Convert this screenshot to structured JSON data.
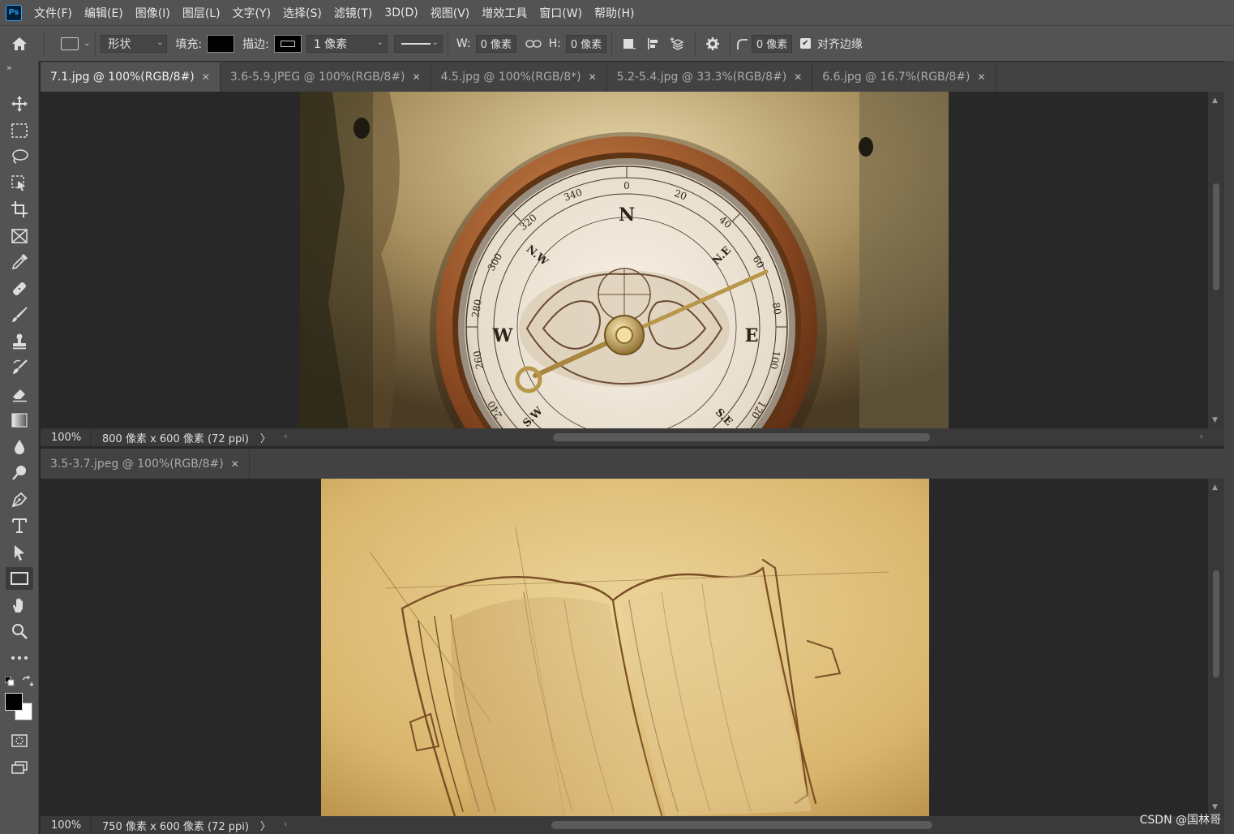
{
  "app": {
    "logo": "Ps"
  },
  "menu": [
    "文件(F)",
    "编辑(E)",
    "图像(I)",
    "图层(L)",
    "文字(Y)",
    "选择(S)",
    "滤镜(T)",
    "3D(D)",
    "视图(V)",
    "增效工具",
    "窗口(W)",
    "帮助(H)"
  ],
  "options": {
    "mode": "形状",
    "fill_label": "填充:",
    "stroke_label": "描边:",
    "stroke_width": "1 像素",
    "w_label": "W:",
    "w_value": "0 像素",
    "h_label": "H:",
    "h_value": "0 像素",
    "radius_value": "0 像素",
    "align_edges_label": "对齐边缘",
    "align_edges_checked": true
  },
  "tools": [
    "move-tool",
    "rectangular-marquee-tool",
    "lasso-tool",
    "object-selection-tool",
    "crop-tool",
    "frame-tool",
    "eyedropper-tool",
    "healing-brush-tool",
    "brush-tool",
    "clone-stamp-tool",
    "history-brush-tool",
    "eraser-tool",
    "gradient-tool",
    "blur-tool",
    "dodge-tool",
    "pen-tool",
    "type-tool",
    "path-selection-tool",
    "rectangle-tool",
    "hand-tool",
    "zoom-tool",
    "more-tools"
  ],
  "active_tool": "rectangle-tool",
  "colors": {
    "foreground": "#000000",
    "background": "#ffffff",
    "accent": "#31a8ff",
    "panel": "#535353",
    "workspace": "#282828"
  },
  "top_pane": {
    "tabs": [
      {
        "label": "7.1.jpg @ 100%(RGB/8#)",
        "active": true
      },
      {
        "label": "3.6-5.9.JPEG @ 100%(RGB/8#)",
        "active": false
      },
      {
        "label": "4.5.jpg @ 100%(RGB/8*)",
        "active": false
      },
      {
        "label": "5.2-5.4.jpg @ 33.3%(RGB/8#)",
        "active": false
      },
      {
        "label": "6.6.jpg @ 16.7%(RGB/8#)",
        "active": false
      }
    ],
    "zoom": "100%",
    "doc_info": "800 像素 x 600 像素 (72 ppi)",
    "compass": {
      "cardinals": [
        "N",
        "E",
        "W"
      ],
      "intercardinals": [
        "N.W",
        "N.E",
        "S.W",
        "S.E"
      ],
      "degrees": [
        "0",
        "20",
        "40",
        "60",
        "80",
        "100",
        "120",
        "340",
        "320",
        "300",
        "280",
        "260",
        "240"
      ]
    }
  },
  "bottom_pane": {
    "tabs": [
      {
        "label": "3.5-3.7.jpeg @ 100%(RGB/8#)",
        "active": false
      }
    ],
    "zoom": "100%",
    "doc_info": "750 像素 x 600 像素 (72 ppi)"
  },
  "watermark": "CSDN @国林哥"
}
